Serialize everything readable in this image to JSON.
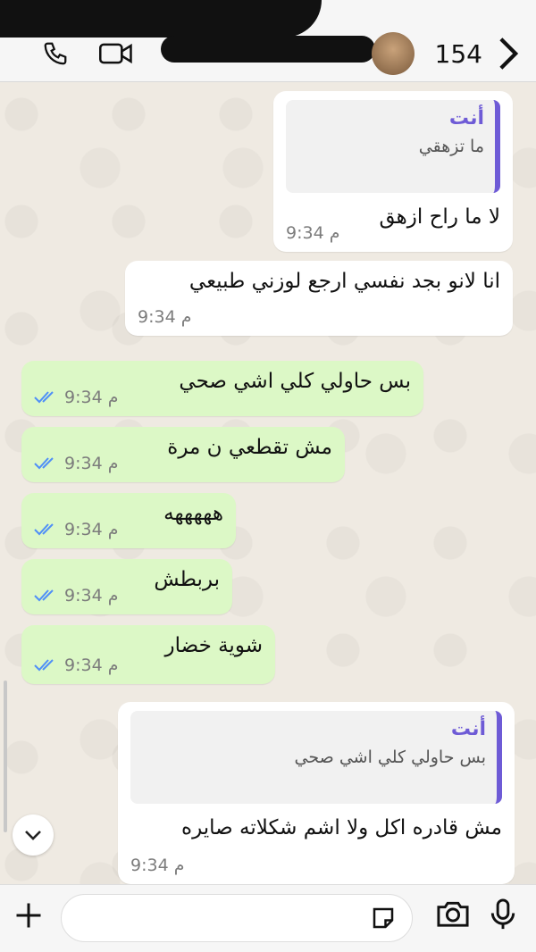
{
  "header": {
    "participant_count": "154"
  },
  "messages": [
    {
      "type": "in",
      "quote_author": "أنت",
      "quote_text": "ما تزهقي",
      "text": "لا ما راح ازهق",
      "time": "9:34 م"
    },
    {
      "type": "in",
      "text": "انا لانو بجد نفسي ارجع لوزني طبيعي",
      "time": "9:34 م"
    },
    {
      "type": "out",
      "text": "بس حاولي كلي اشي صحي",
      "time": "9:34 م"
    },
    {
      "type": "out",
      "text": "مش تقطعي ن مرة",
      "time": "9:34 م"
    },
    {
      "type": "out",
      "text": "هههههه",
      "time": "9:34 م"
    },
    {
      "type": "out",
      "text": "بربطش",
      "time": "9:34 م"
    },
    {
      "type": "out",
      "text": "شوية خضار",
      "time": "9:34 م"
    },
    {
      "type": "in",
      "quote_author": "أنت",
      "quote_text": "بس حاولي كلي اشي صحي",
      "text": "مش قادره اكل ولا اشم شكلاته صايره",
      "time": "9:34 م"
    }
  ],
  "composer": {
    "value": "",
    "placeholder": ""
  },
  "colors": {
    "outgoing_bubble": "#dcf8c6",
    "incoming_bubble": "#ffffff",
    "quote_accent": "#6e5bd6",
    "read_ticks": "#4f8ff7"
  },
  "icons": [
    "phone-icon",
    "video-icon",
    "chevron-right-icon",
    "chevron-down-icon",
    "plus-icon",
    "sticker-icon",
    "camera-icon",
    "mic-icon",
    "read-ticks-icon"
  ]
}
